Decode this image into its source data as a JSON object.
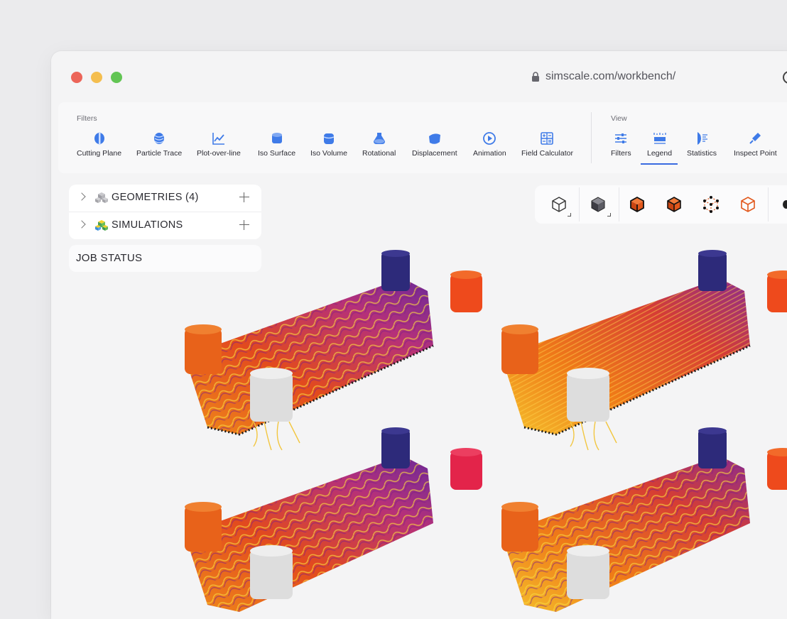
{
  "browser": {
    "url": "simscale.com/workbench/"
  },
  "toolbar": {
    "filters_label": "Filters",
    "view_label": "View",
    "filters": [
      {
        "label": "Cutting Plane",
        "icon": "cutting-plane-icon"
      },
      {
        "label": "Particle Trace",
        "icon": "particle-trace-icon"
      },
      {
        "label": "Plot-over-line",
        "icon": "plot-over-line-icon"
      },
      {
        "label": "Iso Surface",
        "icon": "iso-surface-icon"
      },
      {
        "label": "Iso Volume",
        "icon": "iso-volume-icon"
      },
      {
        "label": "Rotational",
        "icon": "rotational-icon"
      },
      {
        "label": "Displacement",
        "icon": "displacement-icon"
      },
      {
        "label": "Animation",
        "icon": "animation-icon"
      },
      {
        "label": "Field Calculator",
        "icon": "field-calculator-icon"
      }
    ],
    "view": [
      {
        "label": "Filters",
        "icon": "sliders-icon"
      },
      {
        "label": "Legend",
        "icon": "legend-icon",
        "active": true
      },
      {
        "label": "Statistics",
        "icon": "statistics-icon"
      },
      {
        "label": "Inspect Point",
        "icon": "pipette-icon"
      }
    ]
  },
  "tree": {
    "geometries": {
      "label": "GEOMETRIES",
      "count": "(4)"
    },
    "simulations": {
      "label": "SIMULATIONS"
    }
  },
  "job_status": {
    "label": "JOB STATUS"
  },
  "colors": {
    "accent": "#2f6fde",
    "orange": "#e8561a"
  }
}
